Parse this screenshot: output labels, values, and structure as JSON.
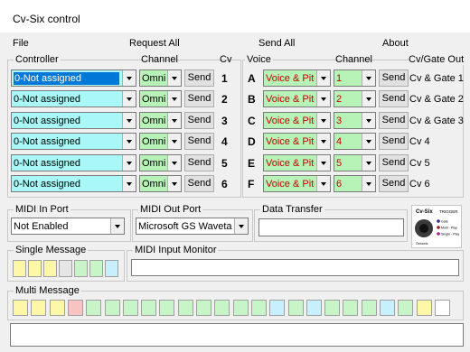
{
  "window": {
    "title": "Cv-Six control"
  },
  "menu": {
    "file": "File",
    "request_all": "Request All",
    "send_all": "Send All",
    "about": "About"
  },
  "controller_group": {
    "label": "Controller",
    "channel_header": "Channel",
    "cv_header": "Cv"
  },
  "voice_group": {
    "label": "Voice",
    "channel_header": "Channel",
    "out_header": "Cv/Gate Out"
  },
  "send_label": "Send",
  "rows": [
    {
      "controller": "0-Not assigned",
      "channel": "Omni",
      "cv": "1",
      "letter": "A",
      "voice": "Voice & Pitch",
      "vchannel": "1",
      "out": "Cv & Gate 1"
    },
    {
      "controller": "0-Not assigned",
      "channel": "Omni",
      "cv": "2",
      "letter": "B",
      "voice": "Voice & Pitch",
      "vchannel": "2",
      "out": "Cv & Gate 2"
    },
    {
      "controller": "0-Not assigned",
      "channel": "Omni",
      "cv": "3",
      "letter": "C",
      "voice": "Voice & Pitch",
      "vchannel": "3",
      "out": "Cv & Gate 3"
    },
    {
      "controller": "0-Not assigned",
      "channel": "Omni",
      "cv": "4",
      "letter": "D",
      "voice": "Voice & Pitch",
      "vchannel": "4",
      "out": "Cv 4"
    },
    {
      "controller": "0-Not assigned",
      "channel": "Omni",
      "cv": "5",
      "letter": "E",
      "voice": "Voice & Pitch",
      "vchannel": "5",
      "out": "Cv 5"
    },
    {
      "controller": "0-Not assigned",
      "channel": "Omni",
      "cv": "6",
      "letter": "F",
      "voice": "Voice & Pitch",
      "vchannel": "6",
      "out": "Cv 6"
    }
  ],
  "midi_in": {
    "label": "MIDI In Port",
    "value": "Not Enabled"
  },
  "midi_out": {
    "label": "MIDI Out Port",
    "value": "Microsoft GS Wavetable Sy"
  },
  "data_transfer": {
    "label": "Data Transfer",
    "value": ""
  },
  "single_message": {
    "label": "Single Message",
    "cell_colors": [
      "#fff7a8",
      "#fff7a8",
      "#fff7a8",
      "#e6e6e6",
      "#c8f5c8",
      "#c8f5c8",
      "#c8f0fc"
    ]
  },
  "midi_input_monitor": {
    "label": "MIDI Input Monitor",
    "value": ""
  },
  "multi_message": {
    "label": "Multi Message",
    "cell_colors": [
      "#fff7a8",
      "#fff7a8",
      "#fff7a8",
      "#f7c3c3",
      "#c8f5c8",
      "#c8f5c8",
      "#c8f5c8",
      "#c8f5c8",
      "#c8f5c8",
      "#c8f5c8",
      "#c8f5c8",
      "#c8f5c8",
      "#c8f5c8",
      "#c8f5c8",
      "#c8f0fc",
      "#c8f5c8",
      "#c8f0fc",
      "#c8f5c8",
      "#c8f5c8",
      "#c8f5c8",
      "#c8f0fc",
      "#c8f5c8",
      "#fff7a8",
      "#ffffff"
    ]
  },
  "logo": {
    "brand": "Cv-Six",
    "tagline": "TRIGGER",
    "legend": [
      "Gate",
      "Multi - Play",
      "Single - Play"
    ],
    "footer": "Octuorix"
  },
  "colors": {
    "controller_bg": "#a9f7f7",
    "channel_bg": "#b7f3b7",
    "voice_text": "#c80000",
    "selection": "#0078d7"
  }
}
